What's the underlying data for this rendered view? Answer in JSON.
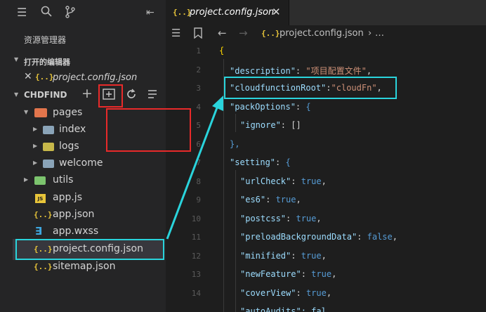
{
  "explorer": {
    "title": "资源管理器",
    "open_editors_label": "打开的编辑器",
    "open_file": "project.config.json",
    "project_name": "CHDFIND"
  },
  "tree": {
    "pages": "pages",
    "index": "index",
    "logs": "logs",
    "welcome": "welcome",
    "utils": "utils",
    "app_js": "app.js",
    "app_json": "app.json",
    "app_wxss": "app.wxss",
    "project_config": "project.config.json",
    "sitemap": "sitemap.json"
  },
  "editor": {
    "tab_title": "project.config.json",
    "breadcrumb": "project.config.json",
    "breadcrumb_more": "…",
    "line_numbers": [
      "1",
      "2",
      "3",
      "4",
      "5",
      "6",
      "7",
      "8",
      "9",
      "10",
      "11",
      "12",
      "13",
      "14"
    ]
  },
  "code": {
    "l1": "{",
    "l2_key": "\"description\"",
    "l2_val": "\"项目配置文件\"",
    "l3_key": "\"cloudfunctionRoot\"",
    "l3_val": "\"cloudFn\"",
    "l4_key": "\"packOptions\"",
    "l5_key": "\"ignore\"",
    "l5_val": "[]",
    "l6": "},",
    "l7_key": "\"setting\"",
    "l8_key": "\"urlCheck\"",
    "l8_val": "true",
    "l9_key": "\"es6\"",
    "l9_val": "true",
    "l10_key": "\"postcss\"",
    "l10_val": "true",
    "l11_key": "\"preloadBackgroundData\"",
    "l11_val": "false",
    "l12_key": "\"minified\"",
    "l12_val": "true",
    "l13_key": "\"newFeature\"",
    "l13_val": "true",
    "l14_key": "\"coverView\"",
    "l14_val": "true",
    "l15_partial": "\"autoAudits\": fal"
  },
  "colors": {
    "highlight": "#2ad4dc",
    "annotation": "#e82a2a"
  }
}
